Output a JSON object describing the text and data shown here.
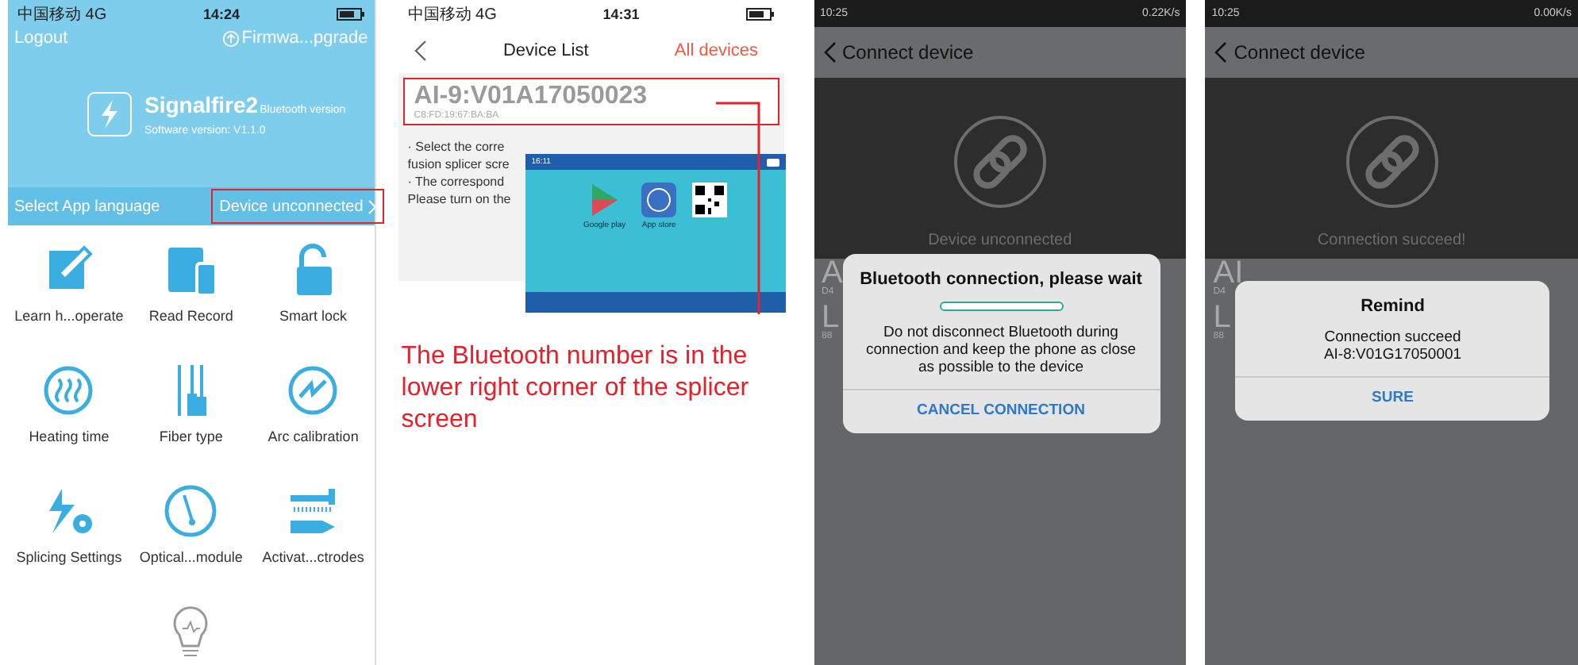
{
  "home": {
    "status": {
      "carrier": "中国移动 4G",
      "time": "14:24"
    },
    "logout": "Logout",
    "firmware": "Firmwa...pgrade",
    "app_name": "Signalfire2",
    "edition": "Bluetooth version",
    "software_version": "Software version: V1.1.0",
    "language": "Select App language",
    "device_status": {
      "label": "Device unconnected",
      "highlighted": true
    },
    "menu": [
      {
        "label": "Learn h...operate"
      },
      {
        "label": "Read Record"
      },
      {
        "label": "Smart lock"
      },
      {
        "label": "Heating time"
      },
      {
        "label": "Fiber type"
      },
      {
        "label": "Arc calibration"
      },
      {
        "label": "Splicing Settings"
      },
      {
        "label": "Optical...module"
      },
      {
        "label": "Activat...ctrodes"
      }
    ]
  },
  "device_list": {
    "status": {
      "carrier": "中国移动 4G",
      "time": "14:31"
    },
    "title": "Device List",
    "action": "All devices",
    "devices": [
      {
        "name": "AI-9:V01A17050023",
        "mac": "C8:FD:19:67:BA:BA",
        "highlighted": true
      }
    ],
    "notes": [
      "· Select the corre",
      "fusion splicer scre",
      "· The correspond",
      "Please turn on the"
    ],
    "splicer_screen": {
      "time": "16:11",
      "stores": [
        "Google play",
        "App store"
      ]
    },
    "caption": "The Bluetooth number is in the lower right corner of the splicer screen"
  },
  "connect": [
    {
      "status": {
        "time": "10:25",
        "speed": "0.22K/s"
      },
      "title": "Connect device",
      "state": "Device unconnected",
      "behind": [
        "A",
        "D4",
        "L",
        "88"
      ],
      "dialog": {
        "kind": "progress",
        "title": "Bluetooth connection, please wait",
        "level": 0,
        "lines": [
          "Do not disconnect Bluetooth during connection and keep the phone as close as possible to the device"
        ],
        "button": "CANCEL CONNECTION"
      }
    },
    {
      "status": {
        "time": "10:25",
        "speed": "0.00K/s"
      },
      "title": "Connect device",
      "state": "Connection succeed!",
      "behind": [
        "AI",
        "D4",
        "L",
        "88"
      ],
      "dialog": {
        "kind": "message",
        "title": "Remind",
        "lines": [
          "Connection succeed",
          "AI-8:V01G17050001"
        ],
        "button": "SURE"
      }
    }
  ]
}
